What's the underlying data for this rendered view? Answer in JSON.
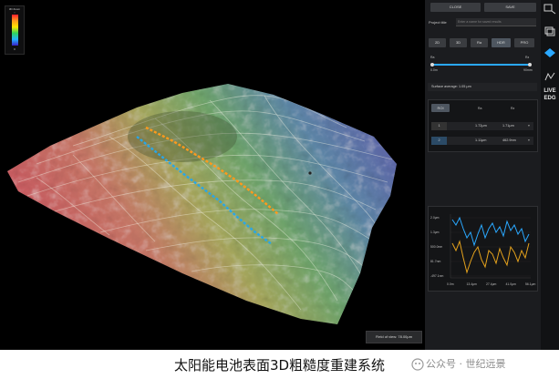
{
  "app": {
    "colors": {
      "viewport_bg": "#000000",
      "panel_bg": "#1b1c1f",
      "accent": "#2aa8ff"
    }
  },
  "legend": {
    "title": "3D Zoom",
    "top_label": "↑",
    "bottom_label": "0"
  },
  "viewport": {
    "scale_note": "Field of view: 78.00μm"
  },
  "panel": {
    "buttons_top": [
      "CLOSE",
      "SAVE"
    ],
    "project_title_label": "Project title",
    "project_title_placeholder": "Enter a name for saved results",
    "mode_buttons": [
      "2D",
      "3D",
      "Ra",
      "HDR",
      "PRO"
    ],
    "range_slider": {
      "left_label": "Ra",
      "right_label": "Rz",
      "min_label": "0.0m",
      "max_label": "90mm"
    },
    "surface_average": "Surface average: 1.05 μm",
    "table": {
      "headers": [
        "ROI",
        "Ra",
        "Rz"
      ],
      "rows": [
        {
          "id": "1",
          "ra": "1.72μm",
          "rz": "1.71μm"
        },
        {
          "id": "2",
          "ra": "1.11μm",
          "rz": "462.9nm"
        }
      ]
    },
    "profile_chart": {
      "y_ticks": [
        "2.0μm",
        "1.3μm",
        "500.0nm",
        "81.7nm",
        "-497.1nm"
      ],
      "x_ticks": [
        "0.0m",
        "13.4μm",
        "27.4μm",
        "41.0μm",
        "56.1μm"
      ]
    }
  },
  "tools": {
    "icons": [
      "zoom-icon",
      "layers-icon",
      "surface-icon",
      "edge-icon"
    ],
    "live_label": "LIVE",
    "live_sub": "EDG"
  },
  "caption": {
    "text": "太阳能电池表面3D粗糙度重建系统",
    "watermark": "公众号 · 世纪远景"
  }
}
